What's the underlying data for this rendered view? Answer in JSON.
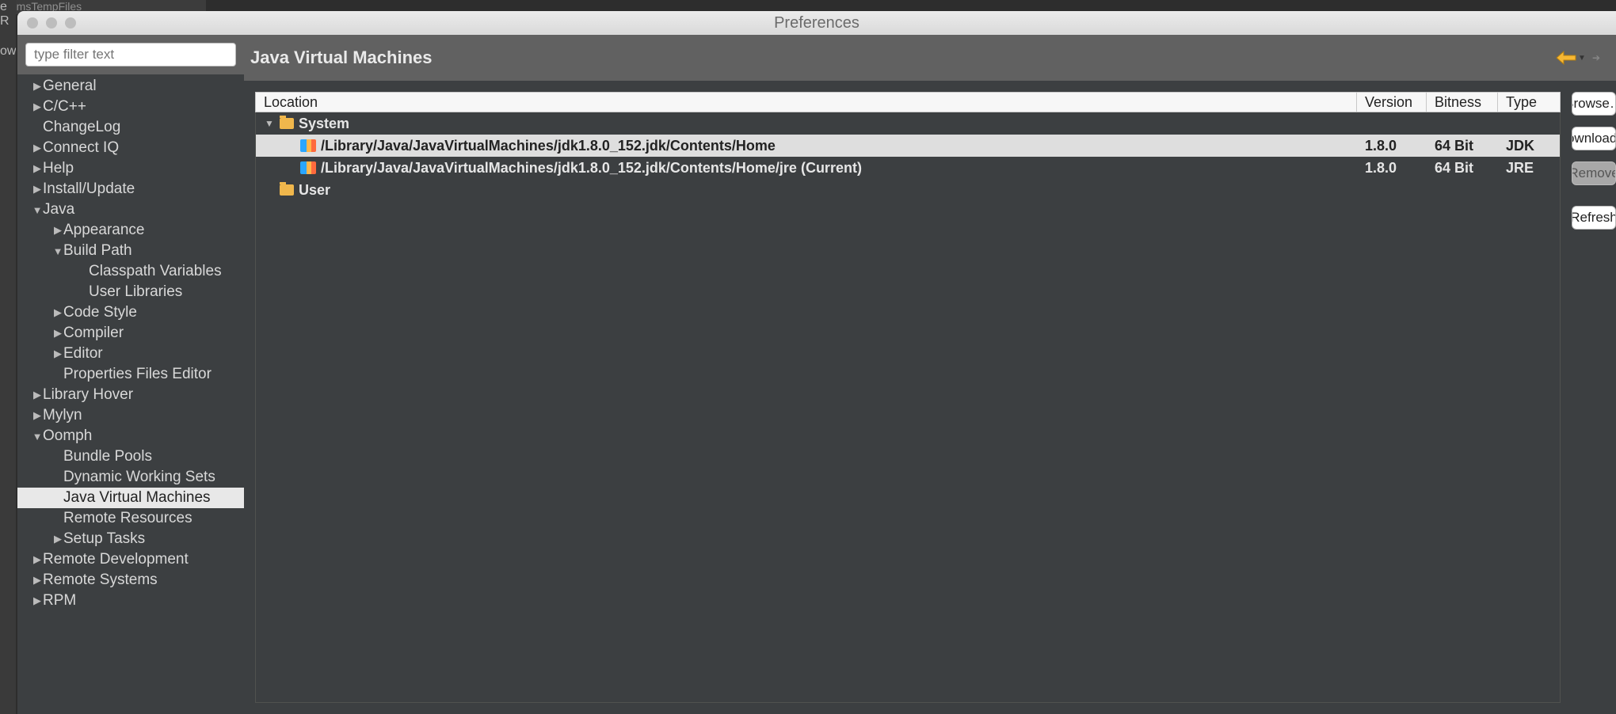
{
  "bg_tab": "stemsTempFiles",
  "bg_strip": [
    "e",
    "R",
    "owe"
  ],
  "window_title": "Preferences",
  "filter_placeholder": "type filter text",
  "page_heading": "Java Virtual Machines",
  "columns": {
    "location": "Location",
    "version": "Version",
    "bitness": "Bitness",
    "type": "Type"
  },
  "groups": [
    {
      "name": "System",
      "expanded": true,
      "rows": [
        {
          "location": "/Library/Java/JavaVirtualMachines/jdk1.8.0_152.jdk/Contents/Home",
          "version": "1.8.0",
          "bitness": "64 Bit",
          "type": "JDK",
          "selected": true
        },
        {
          "location": "/Library/Java/JavaVirtualMachines/jdk1.8.0_152.jdk/Contents/Home/jre (Current)",
          "version": "1.8.0",
          "bitness": "64 Bit",
          "type": "JRE",
          "selected": false
        }
      ]
    },
    {
      "name": "User",
      "expanded": false,
      "rows": []
    }
  ],
  "buttons": {
    "browse": "Browse…",
    "download": "Download…",
    "remove": "Remove",
    "refresh": "Refresh"
  },
  "tree": [
    {
      "label": "General",
      "level": 0,
      "arrow": "right"
    },
    {
      "label": "C/C++",
      "level": 0,
      "arrow": "right"
    },
    {
      "label": "ChangeLog",
      "level": 0,
      "arrow": "none"
    },
    {
      "label": "Connect IQ",
      "level": 0,
      "arrow": "right"
    },
    {
      "label": "Help",
      "level": 0,
      "arrow": "right"
    },
    {
      "label": "Install/Update",
      "level": 0,
      "arrow": "right"
    },
    {
      "label": "Java",
      "level": 0,
      "arrow": "down"
    },
    {
      "label": "Appearance",
      "level": 1,
      "arrow": "right"
    },
    {
      "label": "Build Path",
      "level": 1,
      "arrow": "down"
    },
    {
      "label": "Classpath Variables",
      "level": 2,
      "arrow": "none"
    },
    {
      "label": "User Libraries",
      "level": 2,
      "arrow": "none"
    },
    {
      "label": "Code Style",
      "level": 1,
      "arrow": "right"
    },
    {
      "label": "Compiler",
      "level": 1,
      "arrow": "right"
    },
    {
      "label": "Editor",
      "level": 1,
      "arrow": "right"
    },
    {
      "label": "Properties Files Editor",
      "level": 1,
      "arrow": "none"
    },
    {
      "label": "Library Hover",
      "level": 0,
      "arrow": "right"
    },
    {
      "label": "Mylyn",
      "level": 0,
      "arrow": "right"
    },
    {
      "label": "Oomph",
      "level": 0,
      "arrow": "down"
    },
    {
      "label": "Bundle Pools",
      "level": 1,
      "arrow": "none"
    },
    {
      "label": "Dynamic Working Sets",
      "level": 1,
      "arrow": "none"
    },
    {
      "label": "Java Virtual Machines",
      "level": 1,
      "arrow": "none",
      "selected": true
    },
    {
      "label": "Remote Resources",
      "level": 1,
      "arrow": "none"
    },
    {
      "label": "Setup Tasks",
      "level": 1,
      "arrow": "right"
    },
    {
      "label": "Remote Development",
      "level": 0,
      "arrow": "right"
    },
    {
      "label": "Remote Systems",
      "level": 0,
      "arrow": "right"
    },
    {
      "label": "RPM",
      "level": 0,
      "arrow": "right"
    }
  ]
}
